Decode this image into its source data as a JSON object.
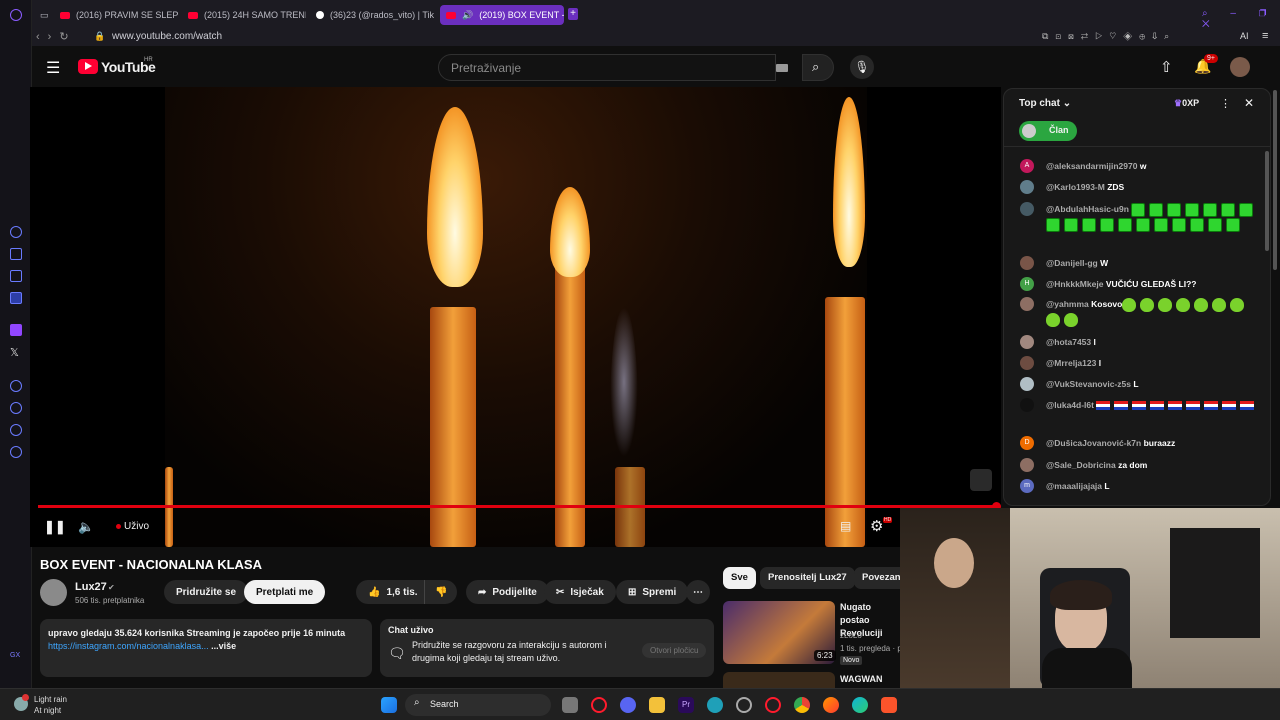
{
  "browser": {
    "tabs": [
      {
        "label": "(2016) PRAVIM SE SLEP P",
        "kind": "youtube"
      },
      {
        "label": "(2015) 24H SAMO TRENII",
        "kind": "youtube"
      },
      {
        "label": "(36)23 (@rados_vito) | Tik",
        "kind": "tiktok"
      },
      {
        "label": "(2019) BOX EVENT - N",
        "kind": "youtube",
        "active": true
      }
    ],
    "url": "www.youtube.com/watch",
    "ai_label": "AI"
  },
  "youtube": {
    "logo_text": "YouTube",
    "region": "HR",
    "search_placeholder": "Pretraživanje",
    "notifications_badge": "9+"
  },
  "player": {
    "live_label": "Uživo",
    "settings_badge": "HD"
  },
  "video": {
    "title": "BOX EVENT - NACIONALNA KLASA",
    "channel": "Lux27",
    "subscribers": "506 tis. pretplatnika",
    "join_label": "Pridružite se",
    "subscribe_label": "Pretplati me",
    "likes": "1,6 tis.",
    "share_label": "Podijelite",
    "clip_label": "Isječak",
    "save_label": "Spremi",
    "description_line": "upravo gledaju 35.624 korisnika  Streaming je započeo prije 16 minuta",
    "description_link": "https://instagram.com/nacionalnaklasa...",
    "more_label": "...više"
  },
  "chat_card": {
    "title": "Chat uživo",
    "text": "Pridružite se razgovoru za interakciju s autorom i drugima koji gledaju taj stream uživo.",
    "button": "Otvori pločicu"
  },
  "related": {
    "chips": [
      "Sve",
      "Prenositelj Lux27",
      "Povezano"
    ],
    "items": [
      {
        "title": "Nugato postao Revoluciji",
        "channel": "zLoLo",
        "meta": "1 tis. pregleda · p",
        "badge": "Novo",
        "duration": "6:23"
      },
      {
        "title": "WAGWAN"
      }
    ]
  },
  "livechat": {
    "header": "Top chat",
    "points": "0XP",
    "member_label": "Član",
    "messages": [
      {
        "author": "@aleksandarmijin2970",
        "text": "w",
        "avatar": "A",
        "color": "#c2185b"
      },
      {
        "author": "@Karlo1993-M",
        "text": "ZDS",
        "avatar": "",
        "color": "#607d8b"
      },
      {
        "author": "@AbdulahHasic-u9n",
        "text": "",
        "avatar": "",
        "color": "#455a64",
        "emotes": 18
      },
      {
        "author": "@Danijell-gg",
        "text": "W",
        "avatar": "",
        "color": "#795548"
      },
      {
        "author": "@HnkkkMkeje",
        "text": "VUČIĆU GLEDAŠ LI??",
        "avatar": "H",
        "color": "#43a047"
      },
      {
        "author": "@yahmma",
        "text": "Kosovo",
        "avatar": "",
        "color": "#8d6e63",
        "hearts": 9
      },
      {
        "author": "@hota7453",
        "text": "l",
        "avatar": "",
        "color": "#a1887f"
      },
      {
        "author": "@Mrrelja123",
        "text": "l",
        "avatar": "",
        "color": "#6d4c41"
      },
      {
        "author": "@VukStevanovic-z5s",
        "text": "L",
        "avatar": "",
        "color": "#b0bec5"
      },
      {
        "author": "@luka4d-l6t",
        "text": "",
        "avatar": "",
        "color": "#111111",
        "flags": 9
      },
      {
        "author": "@DušicaJovanović-k7n",
        "text": "buraazz",
        "avatar": "D",
        "color": "#ef6c00"
      },
      {
        "author": "@Sale_Dobricina",
        "text": "za dom",
        "avatar": "",
        "color": "#8d6e63"
      },
      {
        "author": "@maaalijajaja",
        "text": "L",
        "avatar": "m",
        "color": "#5c6bc0"
      }
    ]
  },
  "taskbar": {
    "weather_title": "Light rain",
    "weather_sub": "At night",
    "search_label": "Search"
  }
}
